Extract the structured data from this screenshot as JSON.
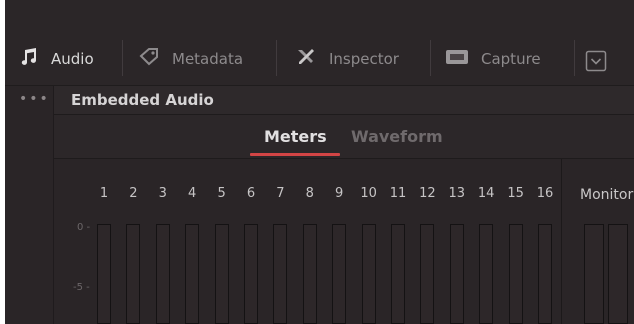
{
  "toolbar": {
    "items": [
      {
        "label": "Audio",
        "icon": "music-note-icon"
      },
      {
        "label": "Metadata",
        "icon": "tag-icon"
      },
      {
        "label": "Inspector",
        "icon": "wrench-screwdriver-icon"
      },
      {
        "label": "Capture",
        "icon": "capture-card-icon"
      }
    ],
    "dropdown_icon": "chevron-down-icon"
  },
  "sidebar": {
    "more_icon": "ellipsis-icon"
  },
  "panel": {
    "title": "Embedded Audio",
    "tabs": [
      {
        "label": "Meters",
        "active": true
      },
      {
        "label": "Waveform",
        "active": false
      }
    ]
  },
  "meters": {
    "channels": [
      "1",
      "2",
      "3",
      "4",
      "5",
      "6",
      "7",
      "8",
      "9",
      "10",
      "11",
      "12",
      "13",
      "14",
      "15",
      "16"
    ],
    "scale": [
      "0 -",
      "-5 -"
    ],
    "monitor_label": "Monitor"
  },
  "colors": {
    "background": "#2b2628",
    "active_tab_underline": "#d34545",
    "text_active": "#e2e0e1",
    "text_inactive": "#6f6a6c"
  }
}
